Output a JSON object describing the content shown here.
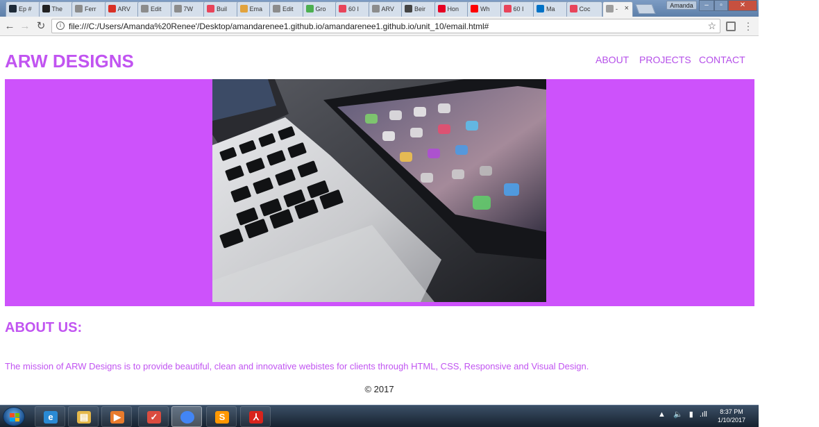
{
  "browser": {
    "tabs": [
      {
        "label": "Ep #",
        "icon": "shield-icon",
        "color": "#1e2a38"
      },
      {
        "label": "The",
        "icon": "g-logo-icon",
        "color": "#222222"
      },
      {
        "label": "Ferr",
        "icon": "page-icon",
        "color": "#8c8c8c"
      },
      {
        "label": "ARV",
        "icon": "gmail-icon",
        "color": "#d93025"
      },
      {
        "label": "Edit",
        "icon": "page-icon",
        "color": "#8c8c8c"
      },
      {
        "label": "7W",
        "icon": "page-icon",
        "color": "#8c8c8c"
      },
      {
        "label": "Buil",
        "icon": "app-icon",
        "color": "#e8445a"
      },
      {
        "label": "Ema",
        "icon": "flower-icon",
        "color": "#e2a33d"
      },
      {
        "label": "Edit",
        "icon": "page-icon",
        "color": "#8c8c8c"
      },
      {
        "label": "Gro",
        "icon": "leaf-icon",
        "color": "#4caf50"
      },
      {
        "label": "60 I",
        "icon": "h-logo-icon",
        "color": "#e8445a"
      },
      {
        "label": "ARV",
        "icon": "page-icon",
        "color": "#8c8c8c"
      },
      {
        "label": "Beir",
        "icon": "heart-icon",
        "color": "#444444"
      },
      {
        "label": "Hon",
        "icon": "pinterest-icon",
        "color": "#e60023"
      },
      {
        "label": "Wh",
        "icon": "youtube-icon",
        "color": "#ff0000"
      },
      {
        "label": "60 I",
        "icon": "h-logo-icon",
        "color": "#e8445a"
      },
      {
        "label": "Ma",
        "icon": "outlook-icon",
        "color": "#0072c6"
      },
      {
        "label": "Coc",
        "icon": "app-icon",
        "color": "#e8445a"
      }
    ],
    "active_tab": {
      "label": "-",
      "close": "×"
    },
    "user": "Amanda",
    "url": "file:///C:/Users/Amanda%20Renee'/Desktop/amandarenee1.github.io/amandarenee1.github.io/unit_10/email.html#"
  },
  "site": {
    "logo": "ARW DESIGNS",
    "nav": [
      "ABOUT",
      "PROJECTS",
      "CONTACT"
    ],
    "section_title": "ABOUT US:",
    "mission": "The mission of ARW Designs is to provide beautiful, clean and innovative webistes for clients through HTML, CSS, Responsive and Visual Design.",
    "footer": "© 2017",
    "accent": "#c154f1",
    "hero_bg": "#cd52fb"
  },
  "taskbar": {
    "apps": [
      {
        "name": "internet-explorer",
        "glyph": "e",
        "color": "#2a8ad4"
      },
      {
        "name": "file-explorer",
        "glyph": "▤",
        "color": "#e5b84a"
      },
      {
        "name": "media-player",
        "glyph": "▶",
        "color": "#e87b2c"
      },
      {
        "name": "todoist",
        "glyph": "✓",
        "color": "#db4c3f"
      },
      {
        "name": "chrome",
        "glyph": "",
        "color": "#4285f4"
      },
      {
        "name": "sublime-text",
        "glyph": "S",
        "color": "#ff9800"
      },
      {
        "name": "acrobat",
        "glyph": "⅄",
        "color": "#d9241c"
      }
    ],
    "time": "8:37 PM",
    "date": "1/10/2017"
  }
}
